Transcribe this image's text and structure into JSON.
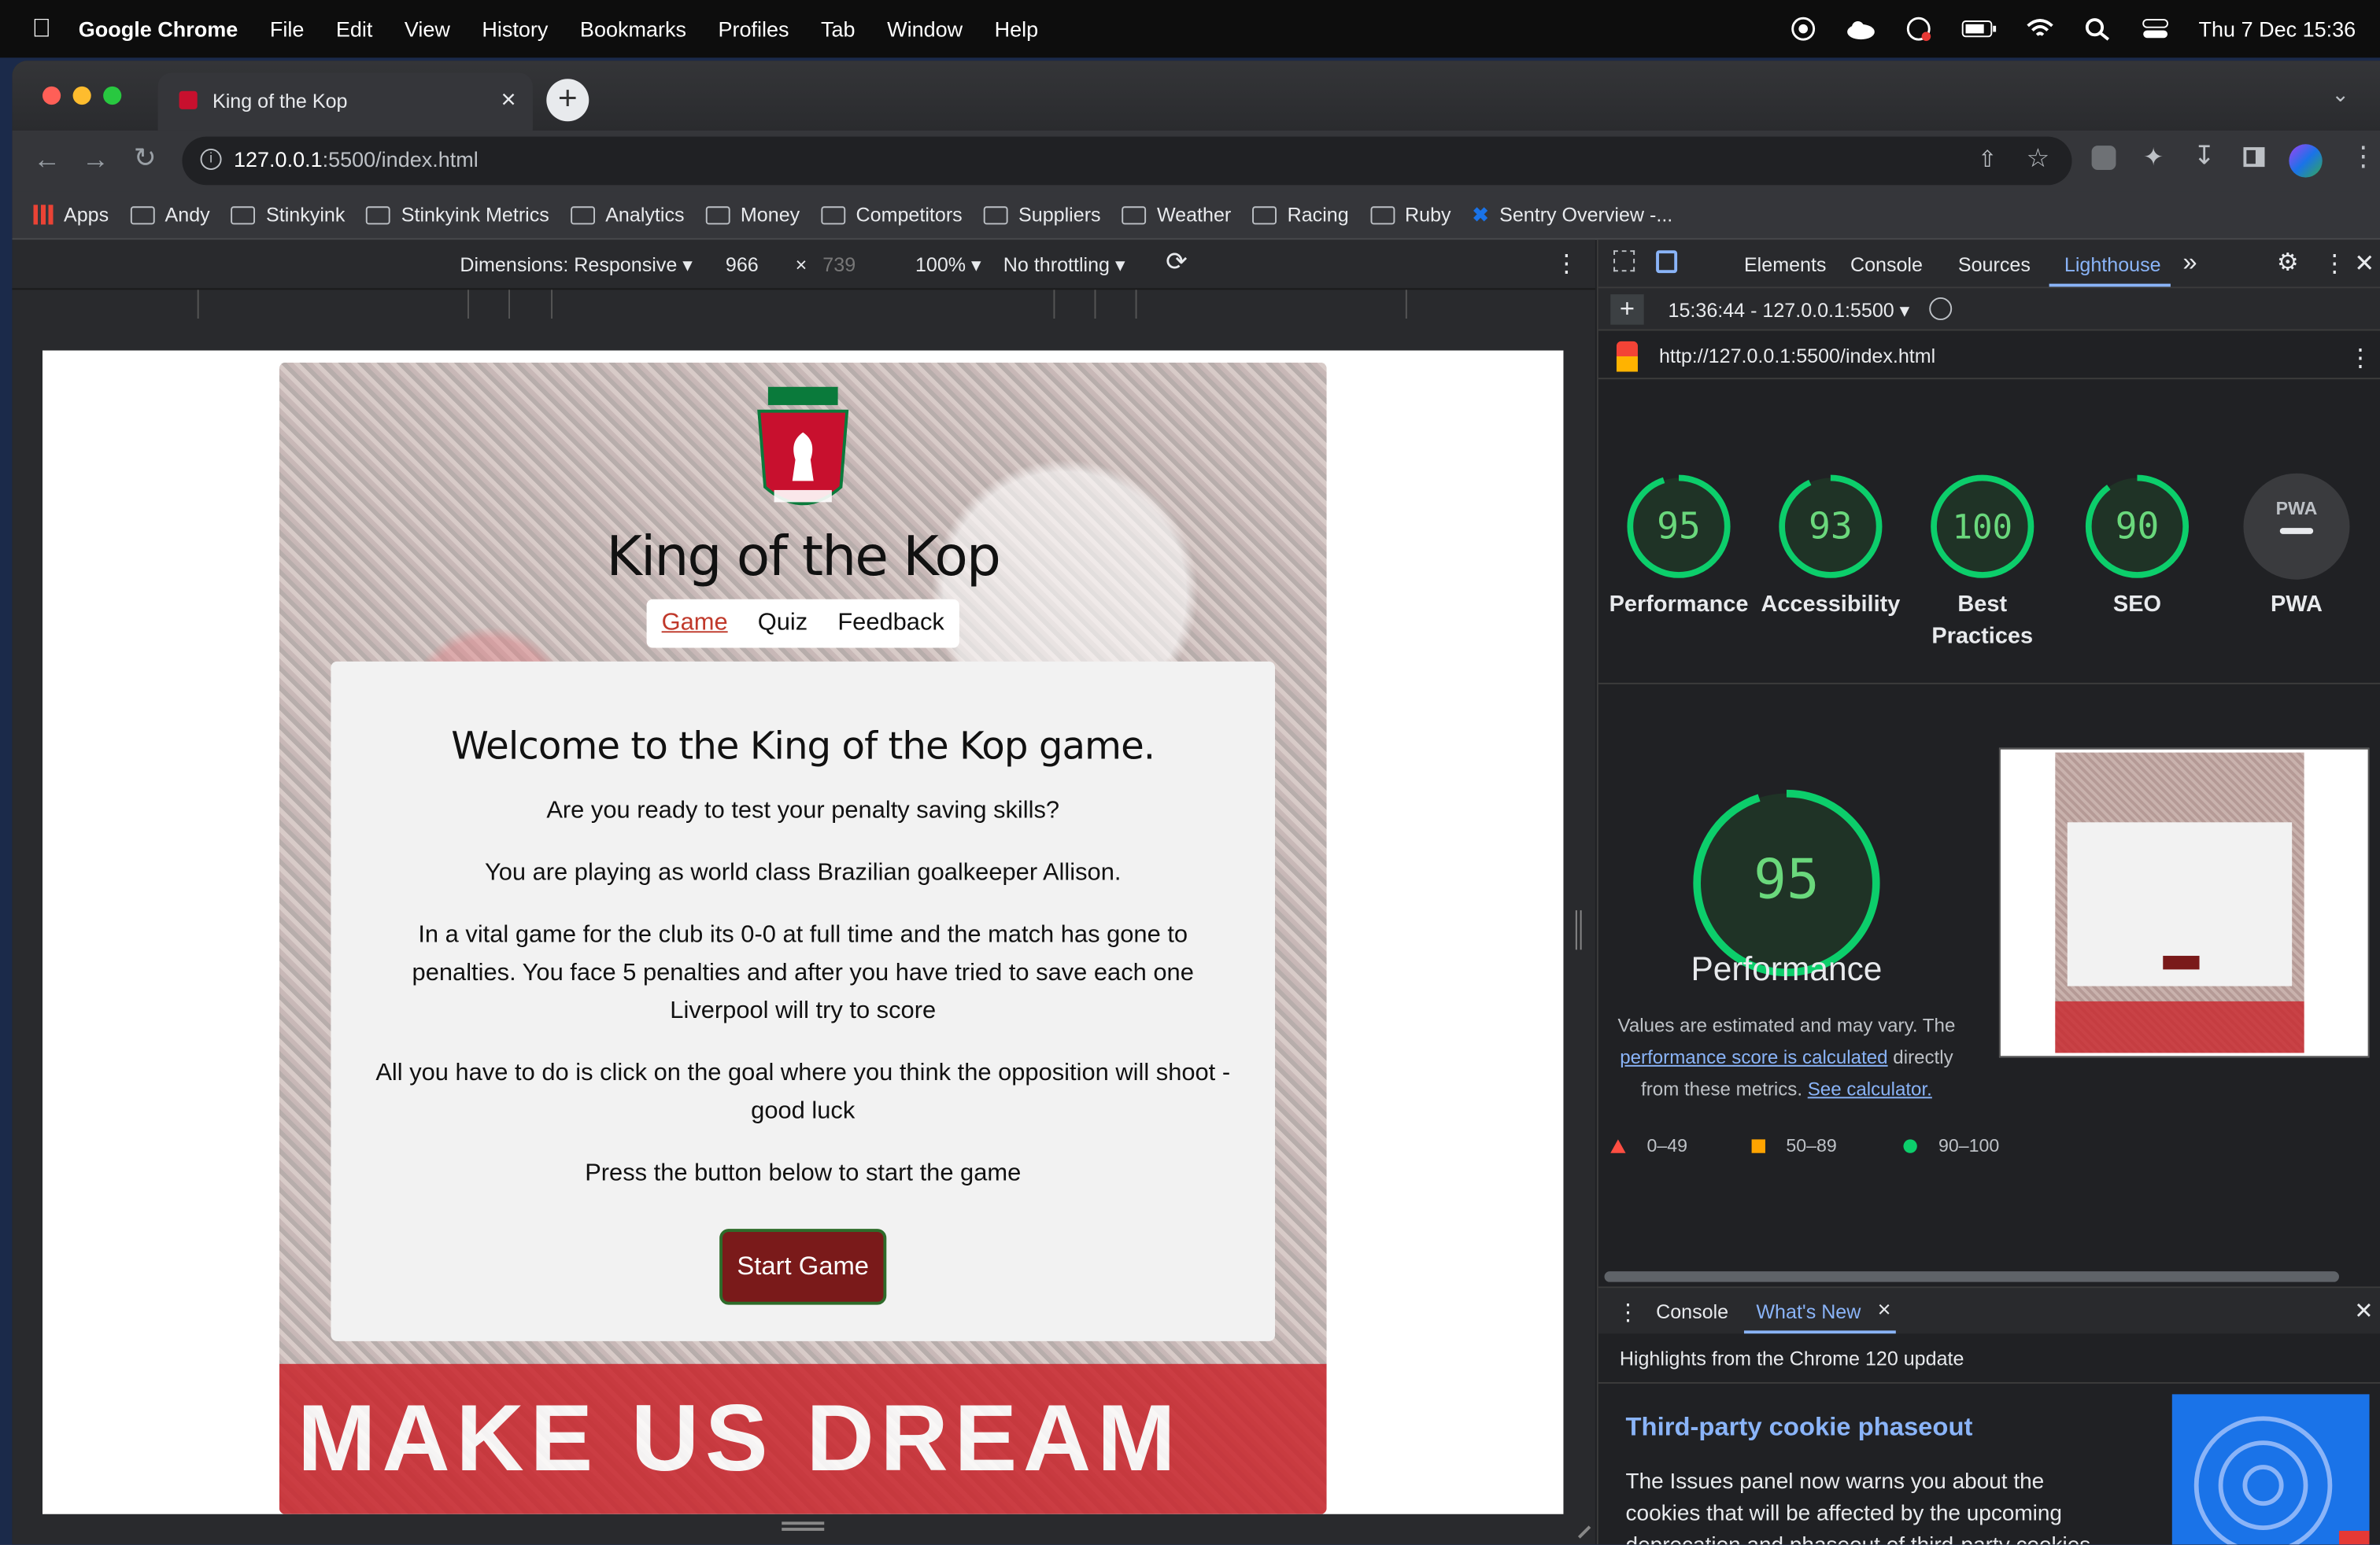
{
  "menubar": {
    "app": "Google Chrome",
    "items": [
      "File",
      "Edit",
      "View",
      "History",
      "Bookmarks",
      "Profiles",
      "Tab",
      "Window",
      "Help"
    ],
    "datetime": "Thu 7 Dec  15:36"
  },
  "tab": {
    "title": "King of the Kop",
    "close": "×",
    "new": "+"
  },
  "omnibox": {
    "host": "127.0.0.1",
    "path": ":5500/index.html"
  },
  "bookmarks": [
    "Apps",
    "Andy",
    "Stinkyink",
    "Stinkyink Metrics",
    "Analytics",
    "Money",
    "Competitors",
    "Suppliers",
    "Weather",
    "Racing",
    "Ruby",
    "Sentry Overview -..."
  ],
  "devbar": {
    "dimensions": "Dimensions: Responsive ▾",
    "width": "966",
    "times": "×",
    "height": "739",
    "zoom": "100% ▾",
    "throttle": "No throttling ▾"
  },
  "page": {
    "title": "King of the Kop",
    "nav": [
      "Game",
      "Quiz",
      "Feedback"
    ],
    "heading": "Welcome to the King of the Kop game.",
    "p1": "Are you ready to test your penalty saving skills?",
    "p2": "You are playing as world class Brazilian goalkeeper Allison.",
    "p3": "In a vital game for the club its 0-0 at full time and the match has gone to penalties. You face 5 penalties and after you have tried to save each one Liverpool will try to score",
    "p4": "All you have to do is click on the goal where you think the opposition will shoot - good luck",
    "p5": "Press the button below to start the game",
    "button": "Start Game",
    "banner": "MAKE US DREAM"
  },
  "devtools": {
    "tabs": [
      "Elements",
      "Console",
      "Sources",
      "Lighthouse"
    ],
    "more": "»",
    "report": "15:36:44 - 127.0.0.1:5500 ▾",
    "url": "http://127.0.0.1:5500/index.html",
    "scores": [
      {
        "value": "95",
        "label": "Performance",
        "fill": 0.95
      },
      {
        "value": "93",
        "label": "Accessibility",
        "fill": 0.93
      },
      {
        "value": "100",
        "label": "Best Practices",
        "fill": 1.0
      },
      {
        "value": "90",
        "label": "SEO",
        "fill": 0.9
      }
    ],
    "pwa": {
      "badge": "PWA",
      "label": "PWA"
    },
    "perf": {
      "value": "95",
      "label": "Performance",
      "fill": 0.95,
      "note_a": "Values are estimated and may vary. The ",
      "note_link": "performance score is calculated",
      "note_b": " directly from these metrics. ",
      "note_link2": "See calculator."
    },
    "legend": [
      "0–49",
      "50–89",
      "90–100"
    ],
    "drawer": {
      "tabs": [
        "Console",
        "What's New"
      ],
      "close": "×",
      "highlight": "Highlights from the Chrome 120 update",
      "title": "Third-party cookie phaseout",
      "body": "The Issues panel now warns you about the cookies that will be affected by the upcoming deprecation and phaseout of third-party cookies."
    },
    "colors": {
      "pass": "#0cce6b",
      "average": "#ffa400",
      "accent": "#8ab4f8"
    }
  }
}
